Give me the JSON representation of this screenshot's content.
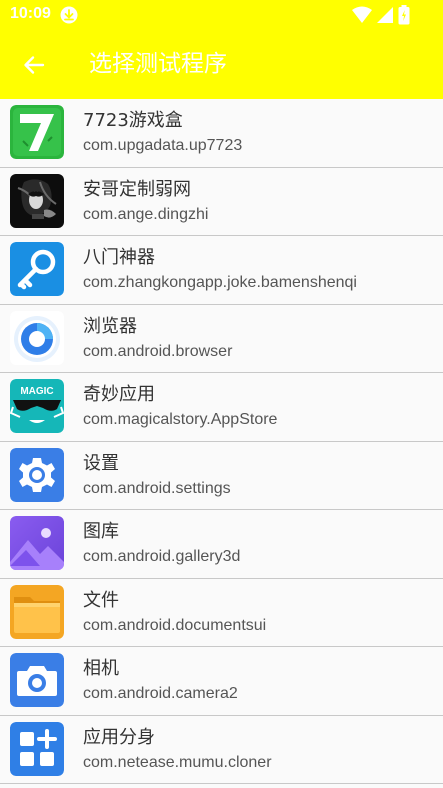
{
  "status_bar": {
    "time": "10:09"
  },
  "app_bar": {
    "title": "选择测试程序",
    "background": "#ffff00"
  },
  "apps": [
    {
      "name": "7723游戏盒",
      "package": "com.upgadata.up7723",
      "icon": "7723-icon"
    },
    {
      "name": "安哥定制弱网",
      "package": "com.ange.dingzhi",
      "icon": "ange-icon"
    },
    {
      "name": "八门神器",
      "package": "com.zhangkongapp.joke.bamenshenqi",
      "icon": "key-wrench-icon"
    },
    {
      "name": "浏览器",
      "package": "com.android.browser",
      "icon": "browser-icon"
    },
    {
      "name": "奇妙应用",
      "package": "com.magicalstory.AppStore",
      "icon": "magic-icon"
    },
    {
      "name": "设置",
      "package": "com.android.settings",
      "icon": "gear-icon"
    },
    {
      "name": "图库",
      "package": "com.android.gallery3d",
      "icon": "gallery-icon"
    },
    {
      "name": "文件",
      "package": "com.android.documentsui",
      "icon": "folder-icon"
    },
    {
      "name": "相机",
      "package": "com.android.camera2",
      "icon": "camera-icon"
    },
    {
      "name": "应用分身",
      "package": "com.netease.mumu.cloner",
      "icon": "cloner-icon"
    }
  ],
  "magic_icon_text": "MAGIC"
}
